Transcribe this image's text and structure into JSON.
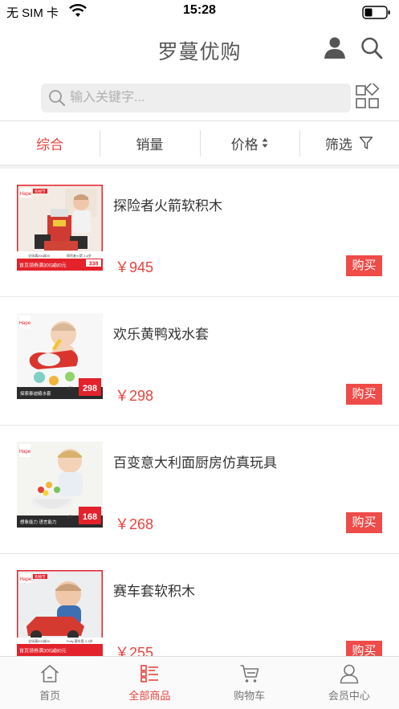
{
  "status_bar": {
    "carrier": "无 SIM 卡",
    "time": "15:28"
  },
  "navbar": {
    "title": "罗蔓优购"
  },
  "search": {
    "placeholder": "输入关键字..."
  },
  "sort_tabs": [
    {
      "label": "综合",
      "active": true
    },
    {
      "label": "销量",
      "active": false
    },
    {
      "label": "价格",
      "active": false,
      "icon": "sort-arrows-icon"
    },
    {
      "label": "筛选",
      "active": false,
      "icon": "filter-icon"
    }
  ],
  "products": [
    {
      "name": "探险者火箭软积木",
      "price": "￥945",
      "buy_label": "购买",
      "thumb": {
        "brand": "Hape",
        "tag": "购物节",
        "price_tag": "338",
        "coupon": "全场满200减20",
        "promo": "首页领券满300减80元",
        "product_line": "探险者火箭 2-6岁"
      }
    },
    {
      "name": "欢乐黄鸭戏水套",
      "price": "￥298",
      "buy_label": "购买",
      "thumb": {
        "brand": "Hape",
        "price_tag": "298",
        "age": "1岁+",
        "promo": "探索泰迪嬉水套"
      }
    },
    {
      "name": "百变意大利面厨房仿真玩具",
      "price": "￥268",
      "buy_label": "购买",
      "thumb": {
        "brand": "Hape",
        "price_tag": "168",
        "age": "3岁+",
        "promo": "想象能力 语言能力"
      }
    },
    {
      "name": "赛车套软积木",
      "price": "￥255",
      "buy_label": "购买",
      "thumb": {
        "brand": "Hape",
        "tag": "购物节",
        "coupon": "全场满200减20",
        "product_line": "Polly 赛车套 2-6岁",
        "promo": "首页领券满300减80元"
      }
    }
  ],
  "tab_bar": [
    {
      "label": "首页",
      "icon": "home-icon",
      "active": false
    },
    {
      "label": "全部商品",
      "icon": "list-icon",
      "active": true
    },
    {
      "label": "购物车",
      "icon": "cart-icon",
      "active": false
    },
    {
      "label": "会员中心",
      "icon": "user-icon",
      "active": false
    }
  ],
  "colors": {
    "accent": "#e8433e",
    "buy_button": "#ef4b48",
    "brand_red": "#e3222b"
  }
}
